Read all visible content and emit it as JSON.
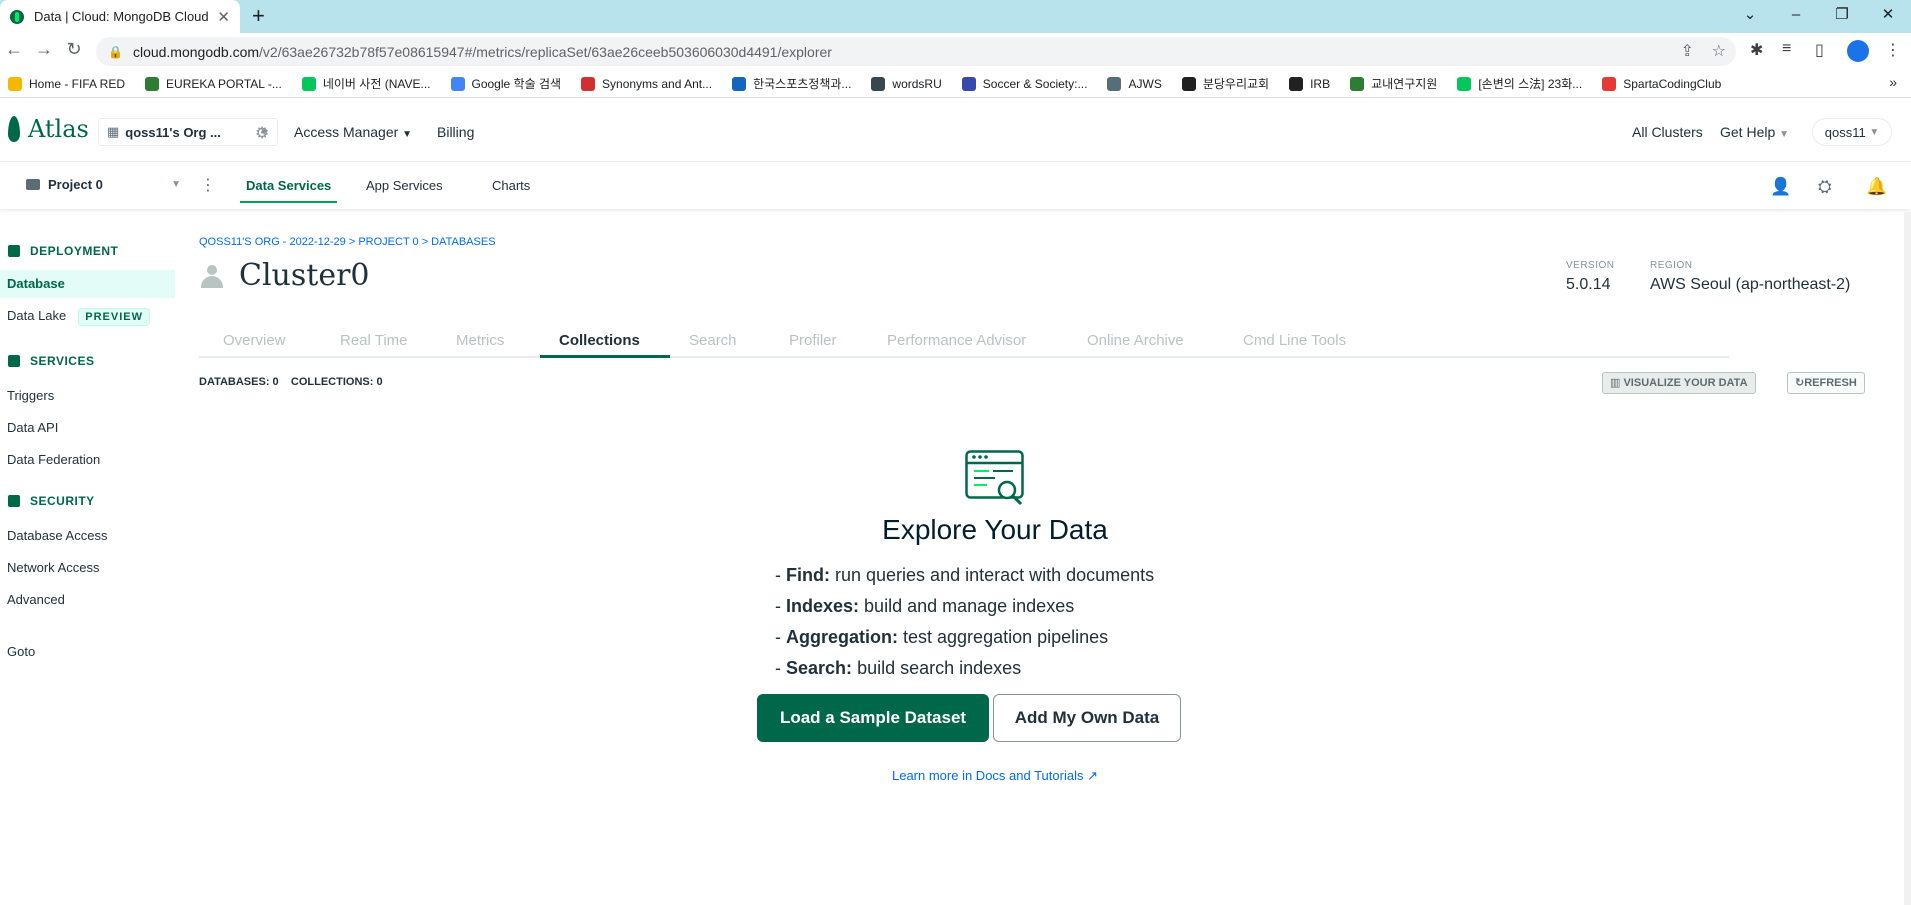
{
  "browser": {
    "tab_title": "Data | Cloud: MongoDB Cloud",
    "url_host": "cloud.mongodb.com",
    "url_path": "/v2/63ae26732b78f57e08615947#/metrics/replicaSet/63ae26ceeb503606030d4491/explorer"
  },
  "bookmarks": [
    {
      "label": "Home - FIFA RED",
      "color": "#f5b800"
    },
    {
      "label": "EUREKA PORTAL -...",
      "color": "#2e7d32"
    },
    {
      "label": "네이버 사전 (NAVE...",
      "color": "#03c75a"
    },
    {
      "label": "Google 학술 검색",
      "color": "#4285f4"
    },
    {
      "label": "Synonyms and Ant...",
      "color": "#d32f2f"
    },
    {
      "label": "한국스포츠정책과...",
      "color": "#1565c0"
    },
    {
      "label": "wordsRU",
      "color": "#37474f"
    },
    {
      "label": "Soccer & Society:...",
      "color": "#3949ab"
    },
    {
      "label": "AJWS",
      "color": "#546e7a"
    },
    {
      "label": "분당우리교회",
      "color": "#212121"
    },
    {
      "label": "IRB",
      "color": "#212121"
    },
    {
      "label": "교내연구지원",
      "color": "#2e7d32"
    },
    {
      "label": "[손변의 스法] 23화...",
      "color": "#03c75a"
    },
    {
      "label": "SpartaCodingClub",
      "color": "#e53935"
    }
  ],
  "header": {
    "logo": "Atlas",
    "org": "qoss11's Org ...",
    "access_manager": "Access Manager",
    "billing": "Billing",
    "all_clusters": "All Clusters",
    "get_help": "Get Help",
    "user": "qoss11"
  },
  "project_bar": {
    "project": "Project 0",
    "tabs": [
      "Data Services",
      "App Services",
      "Charts"
    ]
  },
  "sidebar": {
    "deployment": "DEPLOYMENT",
    "database": "Database",
    "data_lake": "Data Lake",
    "preview": "PREVIEW",
    "services": "SERVICES",
    "triggers": "Triggers",
    "data_api": "Data API",
    "data_federation": "Data Federation",
    "security": "SECURITY",
    "database_access": "Database Access",
    "network_access": "Network Access",
    "advanced": "Advanced",
    "goto": "Goto"
  },
  "main": {
    "breadcrumb": "QOSS11'S ORG - 2022-12-29 > PROJECT 0 > DATABASES",
    "cluster_name": "Cluster0",
    "version_label": "VERSION",
    "version": "5.0.14",
    "region_label": "REGION",
    "region": "AWS Seoul (ap-northeast-2)",
    "tabs": [
      "Overview",
      "Real Time",
      "Metrics",
      "Collections",
      "Search",
      "Profiler",
      "Performance Advisor",
      "Online Archive",
      "Cmd Line Tools"
    ],
    "databases_label": "DATABASES:",
    "databases_count": "0",
    "collections_label": "COLLECTIONS:",
    "collections_count": "0",
    "visualize": "VISUALIZE YOUR DATA",
    "refresh": "REFRESH",
    "explore_title": "Explore Your Data",
    "features": [
      {
        "name": "Find:",
        "desc": "run queries and interact with documents"
      },
      {
        "name": "Indexes:",
        "desc": "build and manage indexes"
      },
      {
        "name": "Aggregation:",
        "desc": "test aggregation pipelines"
      },
      {
        "name": "Search:",
        "desc": "build search indexes"
      }
    ],
    "load_sample": "Load a Sample Dataset",
    "add_own": "Add My Own Data",
    "learn_more": "Learn more in Docs and Tutorials"
  }
}
